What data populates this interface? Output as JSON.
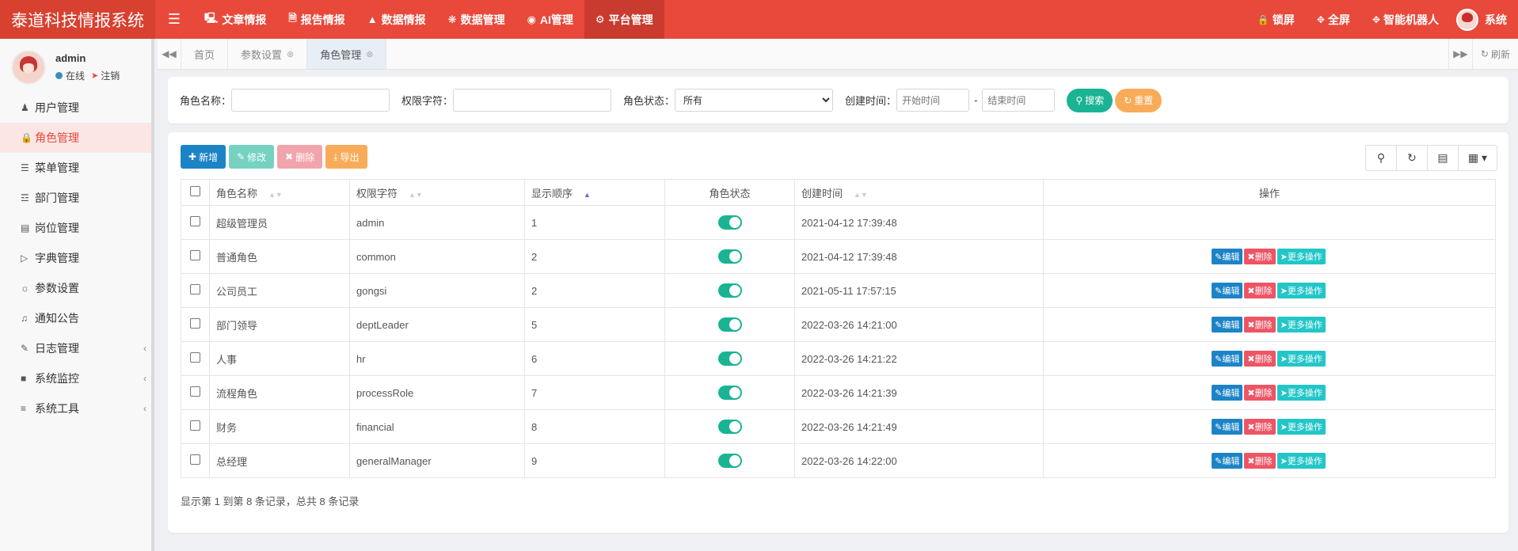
{
  "header": {
    "logo": "泰道科技情报系统",
    "nav": [
      {
        "label": "文章情报",
        "icon": "monitor-icon"
      },
      {
        "label": "报告情报",
        "icon": "file-pdf-icon"
      },
      {
        "label": "数据情报",
        "icon": "area-chart-icon"
      },
      {
        "label": "数据管理",
        "icon": "bug-icon"
      },
      {
        "label": "AI管理",
        "icon": "globe-icon"
      },
      {
        "label": "平台管理",
        "icon": "gear-icon"
      }
    ],
    "right": [
      {
        "label": "锁屏",
        "icon": "lock-icon"
      },
      {
        "label": "全屏",
        "icon": "fullscreen-icon"
      },
      {
        "label": "智能机器人",
        "icon": "robot-icon"
      }
    ],
    "user": "系统"
  },
  "sidebar": {
    "username": "admin",
    "status": "在线",
    "logout": "注销",
    "items": [
      {
        "label": "用户管理",
        "icon": "user-icon"
      },
      {
        "label": "角色管理",
        "icon": "lock-icon"
      },
      {
        "label": "菜单管理",
        "icon": "list-icon"
      },
      {
        "label": "部门管理",
        "icon": "outdent-icon"
      },
      {
        "label": "岗位管理",
        "icon": "id-card-icon"
      },
      {
        "label": "字典管理",
        "icon": "bookmark-icon"
      },
      {
        "label": "参数设置",
        "icon": "sun-icon"
      },
      {
        "label": "通知公告",
        "icon": "bullhorn-icon"
      },
      {
        "label": "日志管理",
        "icon": "edit-icon"
      },
      {
        "label": "系统监控",
        "icon": "video-icon"
      },
      {
        "label": "系统工具",
        "icon": "bars-icon"
      }
    ]
  },
  "tabs": {
    "items": [
      "首页",
      "参数设置",
      "角色管理"
    ],
    "refresh": "刷新"
  },
  "search": {
    "role_name_label": "角色名称：",
    "perm_label": "权限字符：",
    "status_label": "角色状态：",
    "status_value": "所有",
    "created_label": "创建时间：",
    "start_placeholder": "开始时间",
    "end_placeholder": "结束时间",
    "dash": "-",
    "search_btn": "搜索",
    "reset_btn": "重置"
  },
  "toolbar": {
    "add": "新增",
    "edit": "修改",
    "delete": "删除",
    "export": "导出"
  },
  "table": {
    "headers": [
      "角色名称",
      "权限字符",
      "显示顺序",
      "角色状态",
      "创建时间",
      "操作"
    ],
    "rows": [
      {
        "name": "超级管理员",
        "key": "admin",
        "order": "1",
        "time": "2021-04-12 17:39:48",
        "ops": false
      },
      {
        "name": "普通角色",
        "key": "common",
        "order": "2",
        "time": "2021-04-12 17:39:48",
        "ops": true
      },
      {
        "name": "公司员工",
        "key": "gongsi",
        "order": "2",
        "time": "2021-05-11 17:57:15",
        "ops": true
      },
      {
        "name": "部门领导",
        "key": "deptLeader",
        "order": "5",
        "time": "2022-03-26 14:21:00",
        "ops": true
      },
      {
        "name": "人事",
        "key": "hr",
        "order": "6",
        "time": "2022-03-26 14:21:22",
        "ops": true
      },
      {
        "name": "流程角色",
        "key": "processRole",
        "order": "7",
        "time": "2022-03-26 14:21:39",
        "ops": true
      },
      {
        "name": "财务",
        "key": "financial",
        "order": "8",
        "time": "2022-03-26 14:21:49",
        "ops": true
      },
      {
        "name": "总经理",
        "key": "generalManager",
        "order": "9",
        "time": "2022-03-26 14:22:00",
        "ops": true
      }
    ],
    "op_edit": "编辑",
    "op_delete": "删除",
    "op_more": "更多操作",
    "page_info": "显示第 1 到第 8 条记录，总共 8 条记录"
  },
  "colors": {
    "header": "#e8493b",
    "primary": "#1c84c6",
    "success": "#1ab394",
    "danger": "#ed5565",
    "warning": "#f8ac59",
    "info": "#23c6c8"
  }
}
